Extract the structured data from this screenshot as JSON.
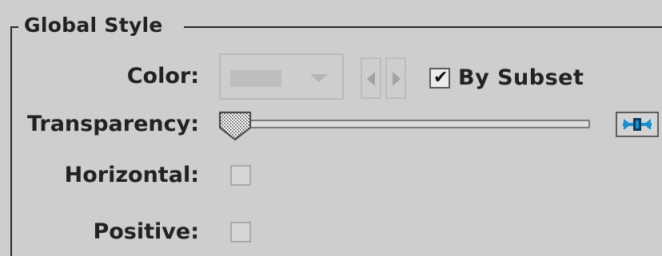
{
  "group": {
    "title": "Global Style"
  },
  "color": {
    "label": "Color:",
    "enabled": false,
    "prev_icon": "triangle-left-icon",
    "next_icon": "triangle-right-icon",
    "by_subset": {
      "label": "By Subset",
      "checked": true
    }
  },
  "transparency": {
    "label": "Transparency:",
    "value": 0.0,
    "reset_icon": "slider-reset-icon"
  },
  "horizontal": {
    "label": "Horizontal:",
    "checked": false
  },
  "positive": {
    "label": "Positive:",
    "checked": false
  },
  "colors": {
    "background": "#cecece",
    "text": "#222222",
    "reset_icon_accent": "#1a8fd0"
  }
}
